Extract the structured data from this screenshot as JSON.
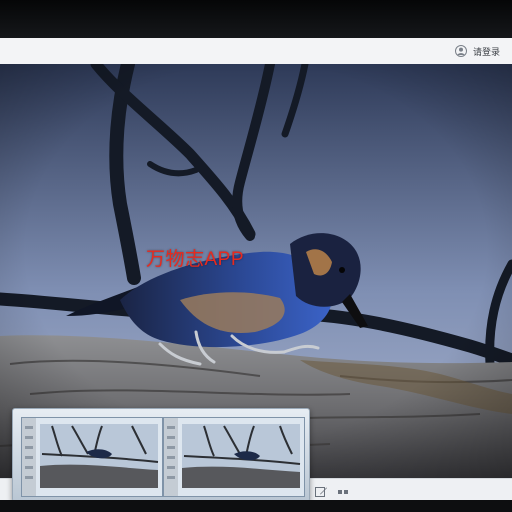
{
  "header": {
    "login_label": "请登录",
    "user_icon": "user-avatar-icon"
  },
  "photo": {
    "subject": "bird-on-branch-image",
    "watermark_text": "万物志APP",
    "watermark_color": "#e72a1f"
  },
  "footer": {
    "icons": [
      "edit-icon",
      "more-icon"
    ]
  },
  "thumbnails": [
    {
      "icon": "bird-thumbnail-image"
    },
    {
      "icon": "bird-thumbnail-image"
    }
  ]
}
